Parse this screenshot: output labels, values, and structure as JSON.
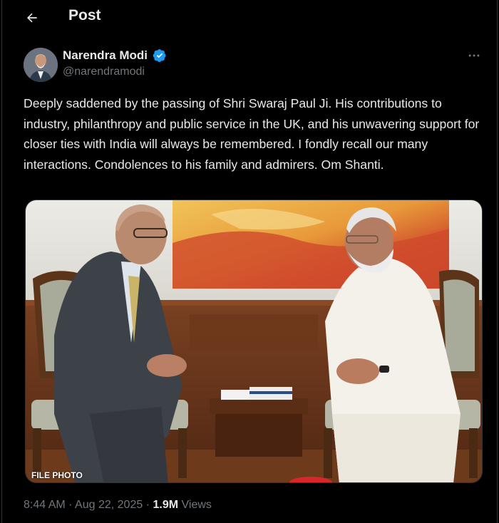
{
  "header": {
    "title": "Post"
  },
  "author": {
    "name": "Narendra Modi",
    "handle": "@narendramodi",
    "verified": true
  },
  "tweet": {
    "text": "Deeply saddened by the passing of Shri Swaraj Paul Ji. His contributions to industry, philanthropy and public service in the UK, and his unwavering support for closer ties with India will always be remembered. I fondly recall our many interactions. Condolences to his family and admirers. Om Shanti.",
    "media_caption": "FILE PHOTO",
    "time": "8:44 AM",
    "date": "Aug 22, 2025",
    "separator": "·",
    "views_count": "1.9M",
    "views_label": "Views"
  },
  "icons": {
    "back": "arrow-left-icon",
    "verified": "verified-badge-icon",
    "more": "more-horizontal-icon"
  },
  "colors": {
    "background": "#000000",
    "text_primary": "#e7e9ea",
    "text_secondary": "#71767b",
    "verified": "#1d9bf0",
    "border": "#2f3336"
  }
}
